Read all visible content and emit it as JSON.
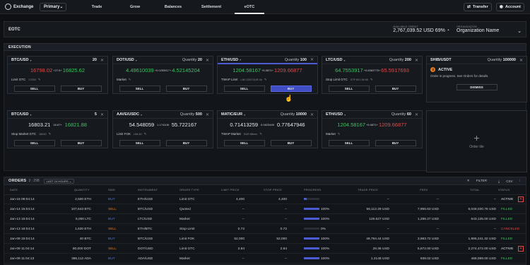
{
  "topbar": {
    "app_name": "Exchange",
    "account_select": "Primary",
    "nav": [
      "Trade",
      "Grow",
      "Balances",
      "Settlement",
      "eOTC"
    ],
    "active_nav": "eOTC",
    "transfer_label": "Transfer",
    "account_label": "Account"
  },
  "eotc": {
    "title": "EOTC",
    "balance_label": "AVAILABLE CREDIT",
    "balance_value": "2,767,039.52",
    "balance_unit": "USD",
    "balance_pct": "69%",
    "org_label": "ORGANIZATION",
    "org_value": "Organization Name"
  },
  "execution": {
    "title": "EXECUTION",
    "tiles": [
      {
        "symbol": "BTC/USD",
        "qty_label": "",
        "qty": "20",
        "bid": "16798.02",
        "spread": "+27.6+",
        "ask": "16825.62",
        "order_type": "Limit GTC",
        "sub": "17000",
        "sell": "SELL",
        "buy": "BUY"
      },
      {
        "symbol": "DOT/USD",
        "qty_label": "Quantity",
        "qty": "20",
        "bid": "4.49610039",
        "spread": "+0.0253517+",
        "ask": "4.52145204",
        "order_type": "Market",
        "sub": "",
        "sell": "SELL",
        "buy": "BUY"
      },
      {
        "symbol": "ETH/USD",
        "qty_label": "Quantity",
        "qty": "100",
        "bid": "1204.58167",
        "spread": "+5.0871+",
        "ask": "1209.66877",
        "order_type": "TWAP Limit",
        "sub": "LIM 1200  DUR 4h",
        "sell": "SELL",
        "buy": "BUY"
      },
      {
        "symbol": "LTC/USD",
        "qty_label": "Quantity",
        "qty": "200",
        "bid": "64.7553917",
        "spread": "+0.8363775+",
        "ask": "65.5917693",
        "order_type": "Stop Limit GTC",
        "sub": "STP 65  LIM 60",
        "sell": "SELL",
        "buy": "BUY"
      },
      {
        "symbol": "BTC/USD",
        "qty_label": "",
        "qty": "5",
        "bid": "16803.21",
        "spread": "18.67+",
        "ask": "16821.88",
        "order_type": "Stop Market GTC",
        "sub": "16000",
        "sell": "SELL",
        "buy": "BUY"
      },
      {
        "symbol": "AAVE/USDC",
        "qty_label": "Quantity",
        "qty": "500",
        "bid": "54.548059",
        "spread": "1.174108",
        "ask": "55.722167",
        "order_type": "Limit FOK",
        "sub": "LIM 60",
        "sell": "SELL",
        "buy": "BUY"
      },
      {
        "symbol": "MATIC/EUR",
        "qty_label": "Quantity",
        "qty": "10000",
        "bid": "0.71413259",
        "spread": "0.0623469",
        "ask": "0.77647946",
        "order_type": "TWAP Market",
        "sub": "DUR 88min",
        "sell": "SELL",
        "buy": "BUY"
      },
      {
        "symbol": "ETH/USD",
        "qty_label": "Quantity",
        "qty": "60",
        "bid": "1204.58167",
        "spread": "+5.0871+",
        "ask": "1209.66877",
        "order_type": "Market",
        "sub": "",
        "sell": "SELL",
        "buy": "BUY"
      }
    ],
    "status_tile": {
      "symbol": "SHIB/USDT",
      "qty_label": "Quantity",
      "qty": "100000",
      "status": "ACTIVE",
      "message": "Order in progress. See Orders for details.",
      "dismiss": "DISMISS"
    },
    "order_tile_label": "Order tile"
  },
  "orders": {
    "title": "ORDERS",
    "count": "3 : 298",
    "period": "LAST 24 HOURS",
    "filter": "FILTER",
    "csv": "CSV",
    "columns": [
      "DATE",
      "QUANTITY",
      "SIDE",
      "INSTRUMENT",
      "ORDER TYPE",
      "LIMIT PRICE",
      "STOP PRICE",
      "PROGRESS",
      "TRADE PRICE",
      "FEES",
      "TOTAL",
      "STATUS"
    ],
    "rows": [
      {
        "date": "Jan-15 09:04:14",
        "qty": "2,500 ETH",
        "side": "BUY",
        "instrument": "ETH/USD",
        "type": "Limit GTC",
        "limit": "4,400",
        "stop": "4,400",
        "progress": 20,
        "progress_label": "",
        "trade": "--",
        "fees": "--",
        "total": "--",
        "status": "ACTIVE"
      },
      {
        "date": "Jan-14 15:04:14",
        "qty": "107,643 BTC",
        "side": "SELL",
        "instrument": "BTC/USD",
        "type": "Quoted",
        "limit": "--",
        "stop": "--",
        "progress": 100,
        "progress_label": "100%",
        "trade": "56,112.29 USD",
        "fees": "7,956.63 USD",
        "total": "6,048,030.76 USD",
        "status": "FILLED"
      },
      {
        "date": "Jan-13 15:04:14",
        "qty": "5,000 LTC",
        "side": "BUY",
        "instrument": "LTC/USD",
        "type": "Market",
        "limit": "--",
        "stop": "--",
        "progress": 100,
        "progress_label": "100%",
        "trade": "128.627 USD",
        "fees": "1,286.27 USD",
        "total": "643,135.00 USD",
        "status": "FILLED"
      },
      {
        "date": "Jan-13 16:04:14",
        "qty": "1,630 ETH",
        "side": "SELL",
        "instrument": "ETH/BTC",
        "type": "Stop-Limit",
        "limit": "0.72",
        "stop": "0.72",
        "progress": 0,
        "progress_label": "0%",
        "trade": "--",
        "fees": "--",
        "total": "--",
        "status": "CANCELED"
      },
      {
        "date": "Jan-09 15:04:14",
        "qty": "40 BTC",
        "side": "BUY",
        "instrument": "BTC/USD",
        "type": "Limit FOK",
        "limit": "52,000",
        "stop": "52,000",
        "progress": 100,
        "progress_label": "100%",
        "trade": "49,794.44 USD",
        "fees": "3,983.72 USD",
        "total": "1,995,241.32 USD",
        "status": "FILLED"
      },
      {
        "date": "Jan-09 11:04:14",
        "qty": "80,000 DOT",
        "side": "SELL",
        "instrument": "DOT/USD",
        "type": "Limit GTC",
        "limit": "2.84",
        "stop": "2.84",
        "progress": 100,
        "progress_label": "100%",
        "trade": "28.36 USD",
        "fees": "5,672.00 USD",
        "total": "2,274,472.00 USD",
        "status": "ACTIVE"
      },
      {
        "date": "Jan-09 11:04:13",
        "qty": "386,112 ADA",
        "side": "BUY",
        "instrument": "ADA/USD",
        "type": "Market",
        "limit": "--",
        "stop": "--",
        "progress": 100,
        "progress_label": "100%",
        "trade": "1.2148 USD",
        "fees": "938.02 USD",
        "total": "469,089.00 USD",
        "status": "FILLED"
      }
    ]
  },
  "colors": {
    "bid": "#e24a4a",
    "ask": "#3bc45e",
    "accent": "#4b5bd6",
    "sell": "#e67a1e",
    "buy": "#4f7bea"
  }
}
